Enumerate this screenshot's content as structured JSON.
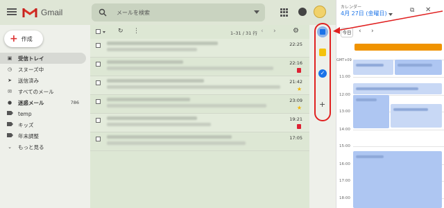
{
  "header": {
    "logo_text": "Gmail",
    "search_placeholder": "メールを検索"
  },
  "sidebar": {
    "compose_label": "作成",
    "items": [
      {
        "label": "受信トレイ",
        "icon": "inbox-icon",
        "active": true
      },
      {
        "label": "スヌーズ中",
        "icon": "clock-icon"
      },
      {
        "label": "送信済み",
        "icon": "send-icon"
      },
      {
        "label": "すべてのメール",
        "icon": "mail-icon"
      },
      {
        "label": "迷惑メール",
        "icon": "alert-icon",
        "count": "786"
      },
      {
        "label": "temp",
        "icon": "label-icon"
      },
      {
        "label": "キッズ",
        "icon": "label-icon"
      },
      {
        "label": "年末調整",
        "icon": "label-icon"
      },
      {
        "label": "もっと見る",
        "icon": "chevron-down-icon"
      }
    ]
  },
  "toolbar": {
    "pager_text": "1–31 / 31 行"
  },
  "emails": [
    {
      "time": "22:25",
      "star": "none"
    },
    {
      "time": "22:16",
      "star": "important"
    },
    {
      "time": "21:42",
      "star": "yellow"
    },
    {
      "time": "23:09",
      "star": "yellow"
    },
    {
      "time": "19:21",
      "star": "important"
    },
    {
      "time": "17:05",
      "star": "none"
    }
  ],
  "calendar": {
    "title": "カレンダー",
    "date": "4月 27日 (金曜日)",
    "today_label": "今日",
    "timezone": "GMT+09",
    "hours": [
      "11:00",
      "12:00",
      "13:00",
      "14:00",
      "15:00",
      "16:00",
      "17:00",
      "18:00"
    ]
  },
  "colors": {
    "accent_red": "#e02020",
    "calendar_blue": "#1a73e8",
    "all_day_event": "#f09300",
    "keep_yellow": "#f4c20d"
  }
}
